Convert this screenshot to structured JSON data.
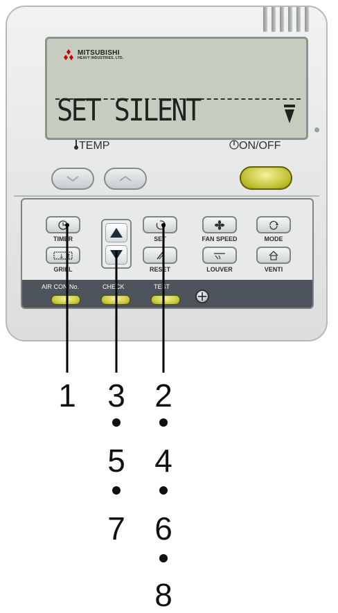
{
  "brand": {
    "name": "MITSUBISHI",
    "sub": "HEAVY INDUSTRIES, LTD."
  },
  "lcd": {
    "text": "SET SILENT"
  },
  "labels": {
    "temp": "TEMP",
    "onoff": "ON/OFF",
    "timer": "TIMER",
    "grill": "GRILL",
    "set": "SET",
    "reset": "RESET",
    "fan_speed": "FAN SPEED",
    "mode": "MODE",
    "louver": "LOUVER",
    "venti": "VENTI",
    "air_con_no": "AIR CON No.",
    "check": "CHECK",
    "test": "TEST"
  },
  "callouts": {
    "col1": [
      "1"
    ],
    "col2": [
      "3",
      "5",
      "7"
    ],
    "col3": [
      "2",
      "4",
      "6",
      "8"
    ]
  },
  "colors": {
    "lcd_background": "#c7ccc1",
    "button_yellow": "#c5c53a",
    "strip_dark": "#4c535a",
    "body": "#e6e8e8"
  },
  "icons": {
    "timer": "clock-icon",
    "grill": "grill-icon",
    "set": "circle-arrow-icon",
    "reset": "slash-icon",
    "fan_speed": "fan-icon",
    "mode": "cycle-icon",
    "louver": "louver-icon",
    "venti": "house-icon",
    "up": "triangle-up-icon",
    "down": "triangle-down-icon",
    "screw": "screw-plus-icon"
  }
}
